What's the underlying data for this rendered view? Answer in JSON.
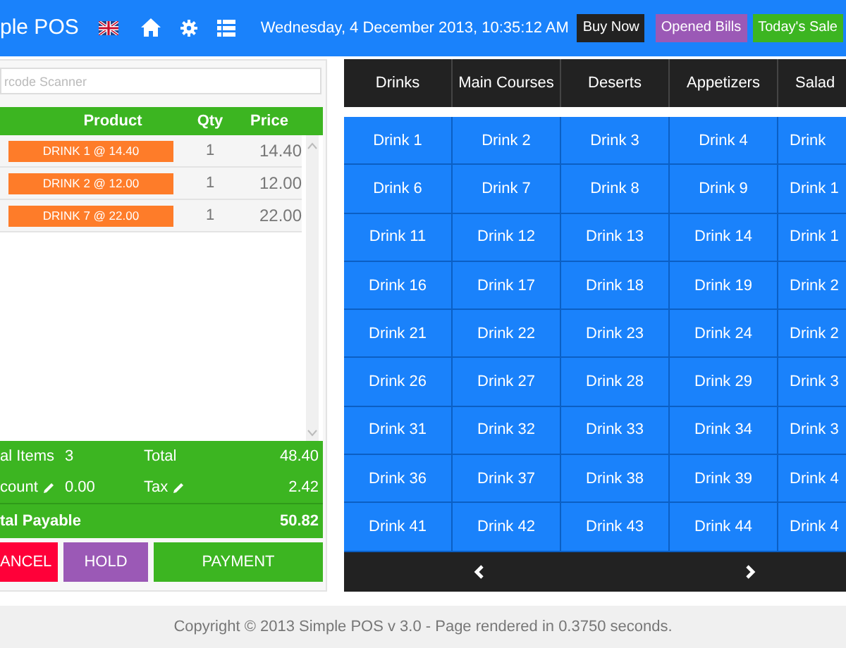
{
  "header": {
    "brand": "ple POS",
    "date": "Wednesday, 4 December 2013, 10:35:12 AM",
    "buttons": [
      {
        "label": "Buy Now",
        "color": "#222222"
      },
      {
        "label": "Opened Bills",
        "color": "#9b59b6"
      },
      {
        "label": "Today's Sale",
        "color": "#3cb521"
      }
    ]
  },
  "barcode": {
    "placeholder": "rcode Scanner"
  },
  "order": {
    "columns": [
      "Product",
      "Qty",
      "Price"
    ],
    "rows": [
      {
        "product": "DRINK 1 @ 14.40",
        "qty": "1",
        "price": "14.40"
      },
      {
        "product": "DRINK 2 @ 12.00",
        "qty": "1",
        "price": "12.00"
      },
      {
        "product": "DRINK 7 @ 22.00",
        "qty": "1",
        "price": "22.00"
      }
    ]
  },
  "totals": {
    "items_label": "al Items",
    "items_value": "3",
    "total_label": "Total",
    "total_value": "48.40",
    "discount_label": "count",
    "discount_value": "0.00",
    "tax_label": "Tax",
    "tax_value": "2.42",
    "payable_label": "tal Payable",
    "payable_value": "50.82"
  },
  "actions": [
    {
      "label": "ANCEL",
      "color": "#ff0039"
    },
    {
      "label": "HOLD",
      "color": "#9b59b6"
    },
    {
      "label": "PAYMENT",
      "color": "#3cb521"
    }
  ],
  "categories": [
    "Drinks",
    "Main Courses",
    "Deserts",
    "Appetizers",
    "Salad"
  ],
  "products": [
    [
      "Drink 1",
      "Drink 2",
      "Drink 3",
      "Drink 4",
      "Drink"
    ],
    [
      "Drink 6",
      "Drink 7",
      "Drink 8",
      "Drink 9",
      "Drink 1"
    ],
    [
      "Drink 11",
      "Drink 12",
      "Drink 13",
      "Drink 14",
      "Drink 1"
    ],
    [
      "Drink 16",
      "Drink 17",
      "Drink 18",
      "Drink 19",
      "Drink 2"
    ],
    [
      "Drink 21",
      "Drink 22",
      "Drink 23",
      "Drink 24",
      "Drink 2"
    ],
    [
      "Drink 26",
      "Drink 27",
      "Drink 28",
      "Drink 29",
      "Drink 3"
    ],
    [
      "Drink 31",
      "Drink 32",
      "Drink 33",
      "Drink 34",
      "Drink 3"
    ],
    [
      "Drink 36",
      "Drink 37",
      "Drink 38",
      "Drink 39",
      "Drink 4"
    ],
    [
      "Drink 41",
      "Drink 42",
      "Drink 43",
      "Drink 44",
      "Drink 4"
    ]
  ],
  "footer": "Copyright © 2013 Simple POS v 3.0 - Page rendered in 0.3750 seconds."
}
